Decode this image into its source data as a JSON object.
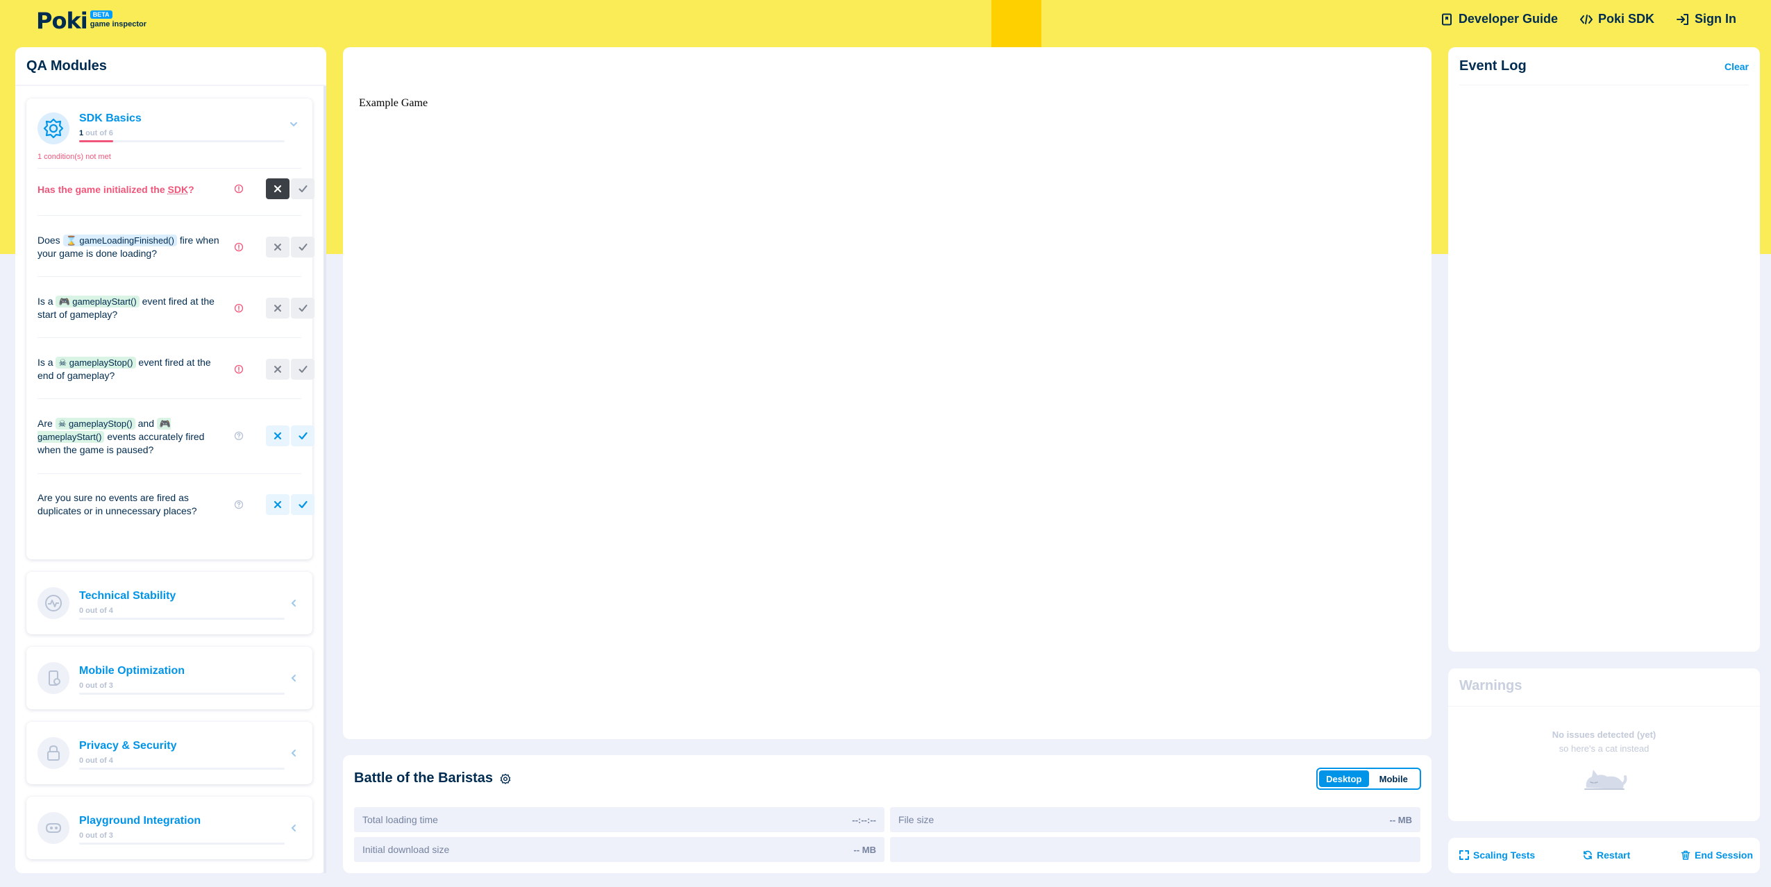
{
  "header": {
    "logo_text": "Poki",
    "beta_badge": "BETA",
    "subtitle": "game inspector",
    "nav": [
      {
        "label": "Developer Guide",
        "icon": "book-icon"
      },
      {
        "label": "Poki SDK",
        "icon": "code-icon"
      },
      {
        "label": "Sign In",
        "icon": "sign-in-icon"
      }
    ]
  },
  "qa": {
    "title": "QA Modules",
    "sdk_basics": {
      "name": "SDK Basics",
      "count_done": "1",
      "count_rest": " out of 6",
      "progress": 0.167,
      "status": "1 condition(s) not met",
      "questions": [
        {
          "pre": "Has the game initialized the ",
          "abbr": "SDK",
          "post": "?",
          "state": "fail",
          "highlight": true
        },
        {
          "pre": "Does ",
          "code": "⌛ gameLoadingFinished()",
          "post": " fire when your game is done loading?",
          "state": "none"
        },
        {
          "pre": "Is a ",
          "code": "🎮 gameplayStart()",
          "post": " event fired at the start of gameplay?",
          "state": "none"
        },
        {
          "pre": "Is a ",
          "code": "☠ gameplayStop()",
          "post": " event fired at the end of gameplay?",
          "state": "none"
        },
        {
          "pre": "Are ",
          "code": "☠ gameplayStop()",
          "mid": " and ",
          "code2": "🎮 gameplayStart()",
          "post": " events accurately fired when the game is paused?",
          "state": "optional"
        },
        {
          "pre": "Are you sure no events are fired as duplicates or in unnecessary places?",
          "state": "optional"
        }
      ]
    },
    "modules": [
      {
        "name": "Technical Stability",
        "count": "0 out of 4",
        "icon": "pulse-icon"
      },
      {
        "name": "Mobile Optimization",
        "count": "0 out of 3",
        "icon": "mobile-icon"
      },
      {
        "name": "Privacy & Security",
        "count": "0 out of 4",
        "icon": "lock-icon"
      },
      {
        "name": "Playground Integration",
        "count": "0 out of 3",
        "icon": "playground-icon"
      }
    ]
  },
  "game": {
    "canvas_text": "Example Game",
    "title": "Battle of the Baristas",
    "toggle": {
      "desktop": "Desktop",
      "mobile": "Mobile",
      "active": "Desktop"
    },
    "stats": {
      "loading_label": "Total loading time",
      "loading_value": "--:--:--",
      "size_label": "File size",
      "size_value": "-- MB",
      "download_label": "Initial download size",
      "download_value": "-- MB"
    }
  },
  "log": {
    "title": "Event Log",
    "clear": "Clear"
  },
  "warnings": {
    "title": "Warnings",
    "msg1": "No issues detected (yet)",
    "msg2": "so here's a cat instead"
  },
  "actions": {
    "scaling": "Scaling Tests",
    "restart": "Restart",
    "end": "End Session"
  },
  "colors": {
    "brand_yellow": "#f9ec56",
    "accent_blue": "#0094e8",
    "danger": "#f0567a",
    "dark": "#002b50"
  }
}
